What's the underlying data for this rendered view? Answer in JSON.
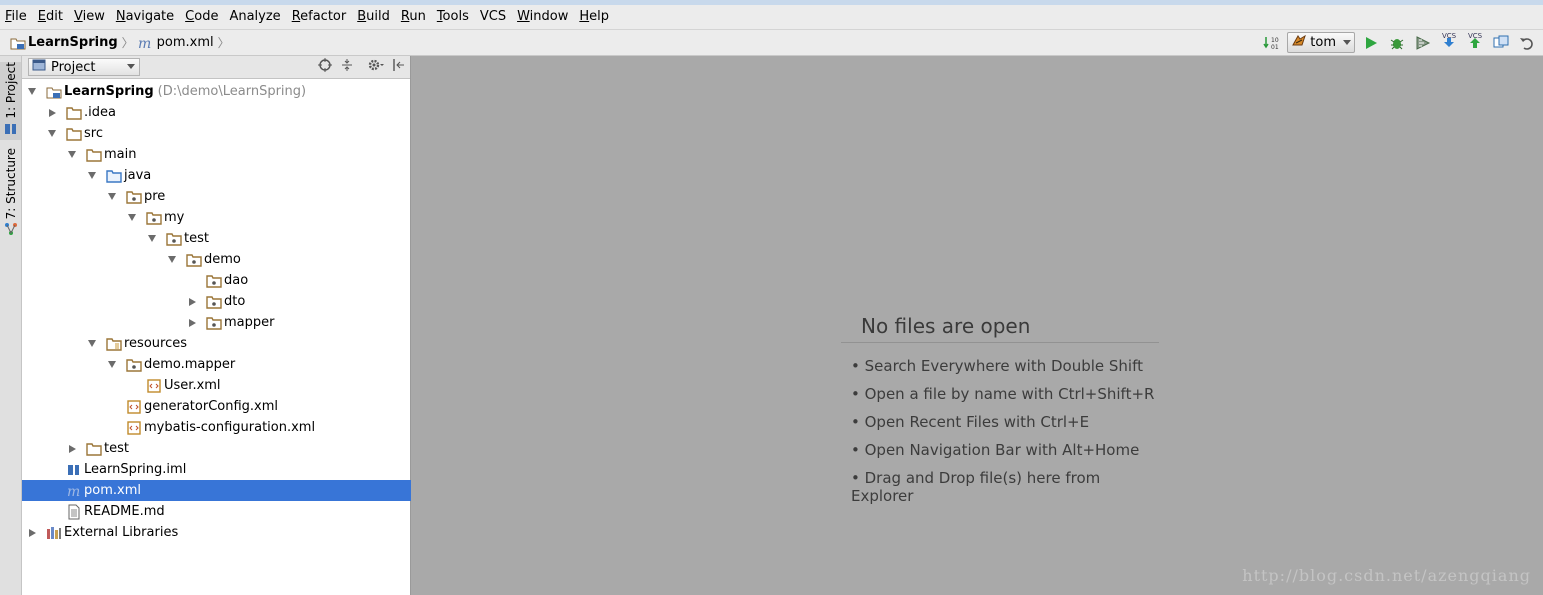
{
  "menubar": {
    "items": [
      {
        "mnemonic": "F",
        "rest": "ile"
      },
      {
        "mnemonic": "E",
        "rest": "dit"
      },
      {
        "mnemonic": "V",
        "rest": "iew"
      },
      {
        "mnemonic": "N",
        "rest": "avigate"
      },
      {
        "mnemonic": "C",
        "rest": "ode"
      },
      {
        "mnemonic": "",
        "rest": "Analyze"
      },
      {
        "mnemonic": "R",
        "rest": "efactor"
      },
      {
        "mnemonic": "B",
        "rest": "uild"
      },
      {
        "mnemonic": "R",
        "rest": "un"
      },
      {
        "mnemonic": "T",
        "rest": "ools"
      },
      {
        "mnemonic": "",
        "rest": "VCS"
      },
      {
        "mnemonic": "W",
        "rest": "indow"
      },
      {
        "mnemonic": "H",
        "rest": "elp"
      }
    ]
  },
  "breadcrumb": {
    "project": "LearnSpring",
    "file": "pom.xml"
  },
  "toolbar": {
    "run_config": "tom",
    "vcs_label": "VCS"
  },
  "left_strip": {
    "project_tab": "1: Project",
    "structure_tab": "7: Structure"
  },
  "project_panel": {
    "view_selector": "Project"
  },
  "tree": [
    {
      "label": "LearnSpring",
      "hint": "(D:\\demo\\LearnSpring)",
      "icon": "module-folder-icon"
    },
    {
      "label": ".idea",
      "icon": "folder-icon"
    },
    {
      "label": "src",
      "icon": "folder-icon"
    },
    {
      "label": "main",
      "icon": "folder-icon"
    },
    {
      "label": "java",
      "icon": "source-folder-icon"
    },
    {
      "label": "pre",
      "icon": "package-icon"
    },
    {
      "label": "my",
      "icon": "package-icon"
    },
    {
      "label": "test",
      "icon": "package-icon"
    },
    {
      "label": "demo",
      "icon": "package-icon"
    },
    {
      "label": "dao",
      "icon": "package-icon"
    },
    {
      "label": "dto",
      "icon": "package-icon"
    },
    {
      "label": "mapper",
      "icon": "package-icon"
    },
    {
      "label": "resources",
      "icon": "resources-folder-icon"
    },
    {
      "label": "demo.mapper",
      "icon": "package-icon"
    },
    {
      "label": "User.xml",
      "icon": "xml-file-icon"
    },
    {
      "label": "generatorConfig.xml",
      "icon": "xml-file-icon"
    },
    {
      "label": "mybatis-configuration.xml",
      "icon": "xml-file-icon"
    },
    {
      "label": "test",
      "icon": "folder-icon"
    },
    {
      "label": "LearnSpring.iml",
      "icon": "iml-file-icon"
    },
    {
      "label": "pom.xml",
      "icon": "maven-file-icon",
      "selected": true
    },
    {
      "label": "README.md",
      "icon": "text-file-icon"
    },
    {
      "label": "External Libraries",
      "icon": "libraries-icon"
    }
  ],
  "editor": {
    "empty_title": "No files are open",
    "hints": [
      "Search Everywhere with Double Shift",
      "Open a file by name with Ctrl+Shift+R",
      "Open Recent Files with Ctrl+E",
      "Open Navigation Bar with Alt+Home",
      "Drag and Drop file(s) here from Explorer"
    ]
  },
  "watermark": "http://blog.csdn.net/azengqiang",
  "colors": {
    "selection": "#3875d7",
    "folder": "#c8a060",
    "run_green": "#2ea640"
  }
}
